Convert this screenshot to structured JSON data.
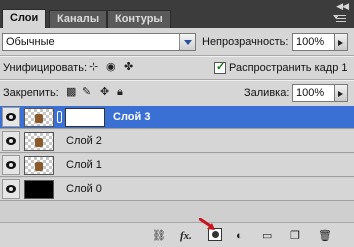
{
  "tabs": [
    {
      "label": "Слои"
    },
    {
      "label": "Каналы"
    },
    {
      "label": "Контуры"
    }
  ],
  "blend_mode": {
    "value": "Обычные"
  },
  "opacity": {
    "label": "Непрозрачность:",
    "value": "100%"
  },
  "unify": {
    "label": "Унифицировать:"
  },
  "propagate": {
    "label": "Распространить кадр 1",
    "checked": true
  },
  "lock": {
    "label": "Закрепить:"
  },
  "fill": {
    "label": "Заливка:",
    "value": "100%"
  },
  "layers": [
    {
      "name": "Слой 3",
      "selected": true,
      "thumb": "transparent-figure",
      "has_mask": true
    },
    {
      "name": "Слой 2",
      "selected": false,
      "thumb": "transparent-figure",
      "has_mask": false
    },
    {
      "name": "Слой 1",
      "selected": false,
      "thumb": "transparent-figure",
      "has_mask": false
    },
    {
      "name": "Слой 0",
      "selected": false,
      "thumb": "black",
      "has_mask": false
    }
  ],
  "bottom_buttons": {
    "fx_label": "fx.",
    "icons": [
      "link-layers-icon",
      "fx-icon",
      "add-mask-icon",
      "adjustment-layer-icon",
      "new-group-icon",
      "new-layer-icon",
      "delete-layer-icon"
    ]
  },
  "colors": {
    "selected_row": "#3a6fd4",
    "panel_bg": "#d6d6d6",
    "titlebar": "#3c3c3c",
    "annotation_arrow": "#c8141b"
  }
}
